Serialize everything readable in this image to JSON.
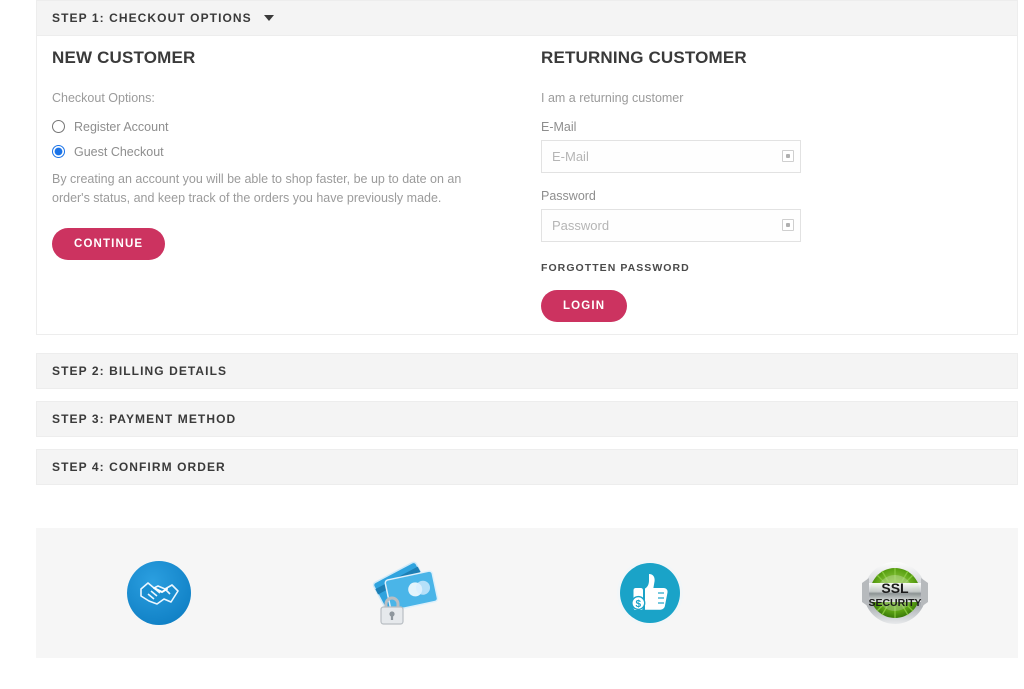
{
  "theme": {
    "accent": "#cc3360",
    "panel_bg": "#f4f4f4",
    "border": "#ededed",
    "badge_strip_bg": "#f6f6f6",
    "radio_checked": "#1a73e8",
    "heading_color": "#3a3a3a",
    "muted_text": "#9b9b9b"
  },
  "steps": [
    {
      "id": "step1",
      "title": "STEP 1: CHECKOUT OPTIONS",
      "expanded": true,
      "caret": "chevron-down-icon"
    },
    {
      "id": "step2",
      "title": "STEP 2: BILLING DETAILS",
      "expanded": false,
      "caret": ""
    },
    {
      "id": "step3",
      "title": "STEP 3: PAYMENT METHOD",
      "expanded": false,
      "caret": ""
    },
    {
      "id": "step4",
      "title": "STEP 4: CONFIRM ORDER",
      "expanded": false,
      "caret": ""
    }
  ],
  "new_customer": {
    "heading": "NEW CUSTOMER",
    "options_label": "Checkout Options:",
    "options": [
      {
        "value": "register",
        "label": "Register Account",
        "checked": false
      },
      {
        "value": "guest",
        "label": "Guest Checkout",
        "checked": true
      }
    ],
    "helper_text": "By creating an account you will be able to shop faster, be up to date on an order's status, and keep track of the orders you have previously made.",
    "continue_label": "CONTINUE"
  },
  "returning_customer": {
    "heading": "RETURNING CUSTOMER",
    "intro": "I am a returning customer",
    "email": {
      "label": "E-Mail",
      "placeholder": "E-Mail",
      "value": "",
      "icon": "autofill-icon"
    },
    "password": {
      "label": "Password",
      "placeholder": "Password",
      "value": "",
      "icon": "autofill-icon"
    },
    "forgotten_password_label": "FORGOTTEN PASSWORD",
    "login_label": "LOGIN"
  },
  "trust_badges": [
    {
      "name": "handshake-badge",
      "icon": "handshake-icon",
      "label": ""
    },
    {
      "name": "secure-payment-badge",
      "icon": "credit-cards-lock-icon",
      "label": ""
    },
    {
      "name": "satisfaction-badge",
      "icon": "thumbs-up-dollar-icon",
      "label": ""
    },
    {
      "name": "ssl-security-badge",
      "icon": "ssl-seal-icon",
      "label_top": "SSL",
      "label_bottom": "SECURITY"
    }
  ]
}
